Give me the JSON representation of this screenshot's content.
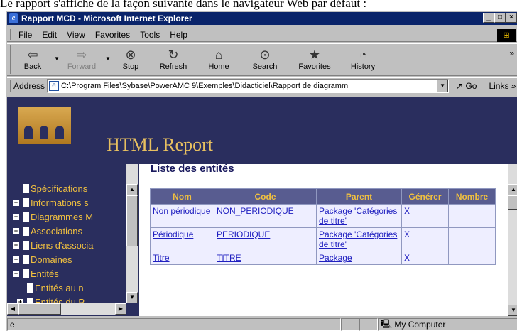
{
  "caption": "Le rapport s'affiche de la façon suivante dans le navigateur Web par défaut :",
  "window": {
    "title": "Rapport MCD - Microsoft Internet Explorer"
  },
  "menu": {
    "file": "File",
    "edit": "Edit",
    "view": "View",
    "favorites": "Favorites",
    "tools": "Tools",
    "help": "Help"
  },
  "toolbar": {
    "back": "Back",
    "forward": "Forward",
    "stop": "Stop",
    "refresh": "Refresh",
    "home": "Home",
    "search": "Search",
    "favorites": "Favorites",
    "history": "History",
    "more": "»"
  },
  "address": {
    "label": "Address",
    "url": "C:\\Program Files\\Sybase\\PowerAMC 9\\Exemples\\Didacticiel\\Rapport de diagramm",
    "go": "Go",
    "links": "Links »"
  },
  "banner": {
    "title": "HTML Report"
  },
  "tree": {
    "items": [
      {
        "label": "Spécifications",
        "expander": ""
      },
      {
        "label": "Informations s",
        "expander": "+"
      },
      {
        "label": "Diagrammes M",
        "expander": "+"
      },
      {
        "label": "Associations",
        "expander": "+"
      },
      {
        "label": "Liens d'associa",
        "expander": "+"
      },
      {
        "label": "Domaines",
        "expander": "+"
      },
      {
        "label": "Entités",
        "expander": "−"
      },
      {
        "label": "Entités au n",
        "expander": ""
      },
      {
        "label": "Entités du P",
        "expander": "+"
      }
    ]
  },
  "main": {
    "title": "Liste des entités",
    "columns": [
      "Nom",
      "Code",
      "Parent",
      "Générer",
      "Nombre"
    ],
    "rows": [
      {
        "nom": "Non périodique",
        "code": "NON_PERIODIQUE",
        "parent": "Package 'Catégories de titre'",
        "generer": "X",
        "nombre": ""
      },
      {
        "nom": "Périodique",
        "code": "PERIODIQUE",
        "parent": "Package 'Catégories de titre'",
        "generer": "X",
        "nombre": ""
      },
      {
        "nom": "Titre",
        "code": "TITRE",
        "parent": "Package",
        "generer": "X",
        "nombre": ""
      }
    ]
  },
  "status": {
    "zone": "My Computer"
  }
}
